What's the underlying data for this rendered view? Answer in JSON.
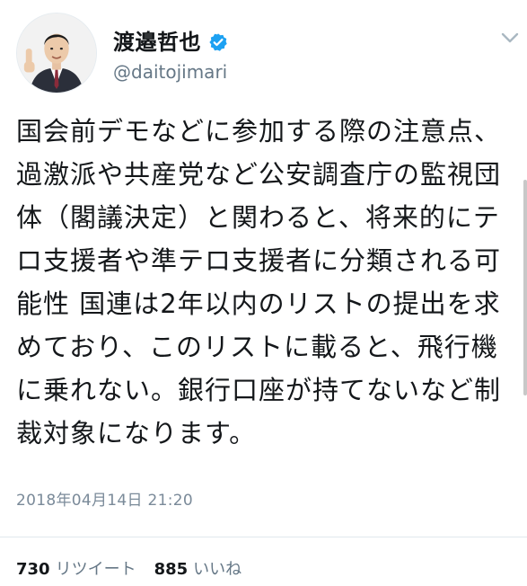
{
  "author": {
    "display_name": "渡邉哲也",
    "handle": "@daitojimari",
    "verified": true
  },
  "tweet": {
    "text": "国会前デモなどに参加する際の注意点、過激派や共産党など公安調査庁の監視団体（閣議決定）と関わると、将来的にテロ支援者や準テロ支援者に分類される可能性 国連は2年以内のリストの提出を求めており、このリストに載ると、飛行機に乗れない。銀行口座が持てないなど制裁対象になります。",
    "timestamp": "2018年04月14日 21:20"
  },
  "stats": {
    "retweets_count": "730",
    "retweets_label": "リツイート",
    "likes_count": "885",
    "likes_label": "いいね"
  },
  "icons": {
    "verified": "verified-badge-icon",
    "menu": "chevron-down-icon"
  },
  "colors": {
    "verified_blue": "#1da1f2",
    "text_primary": "#14171a",
    "text_secondary": "#657786"
  }
}
